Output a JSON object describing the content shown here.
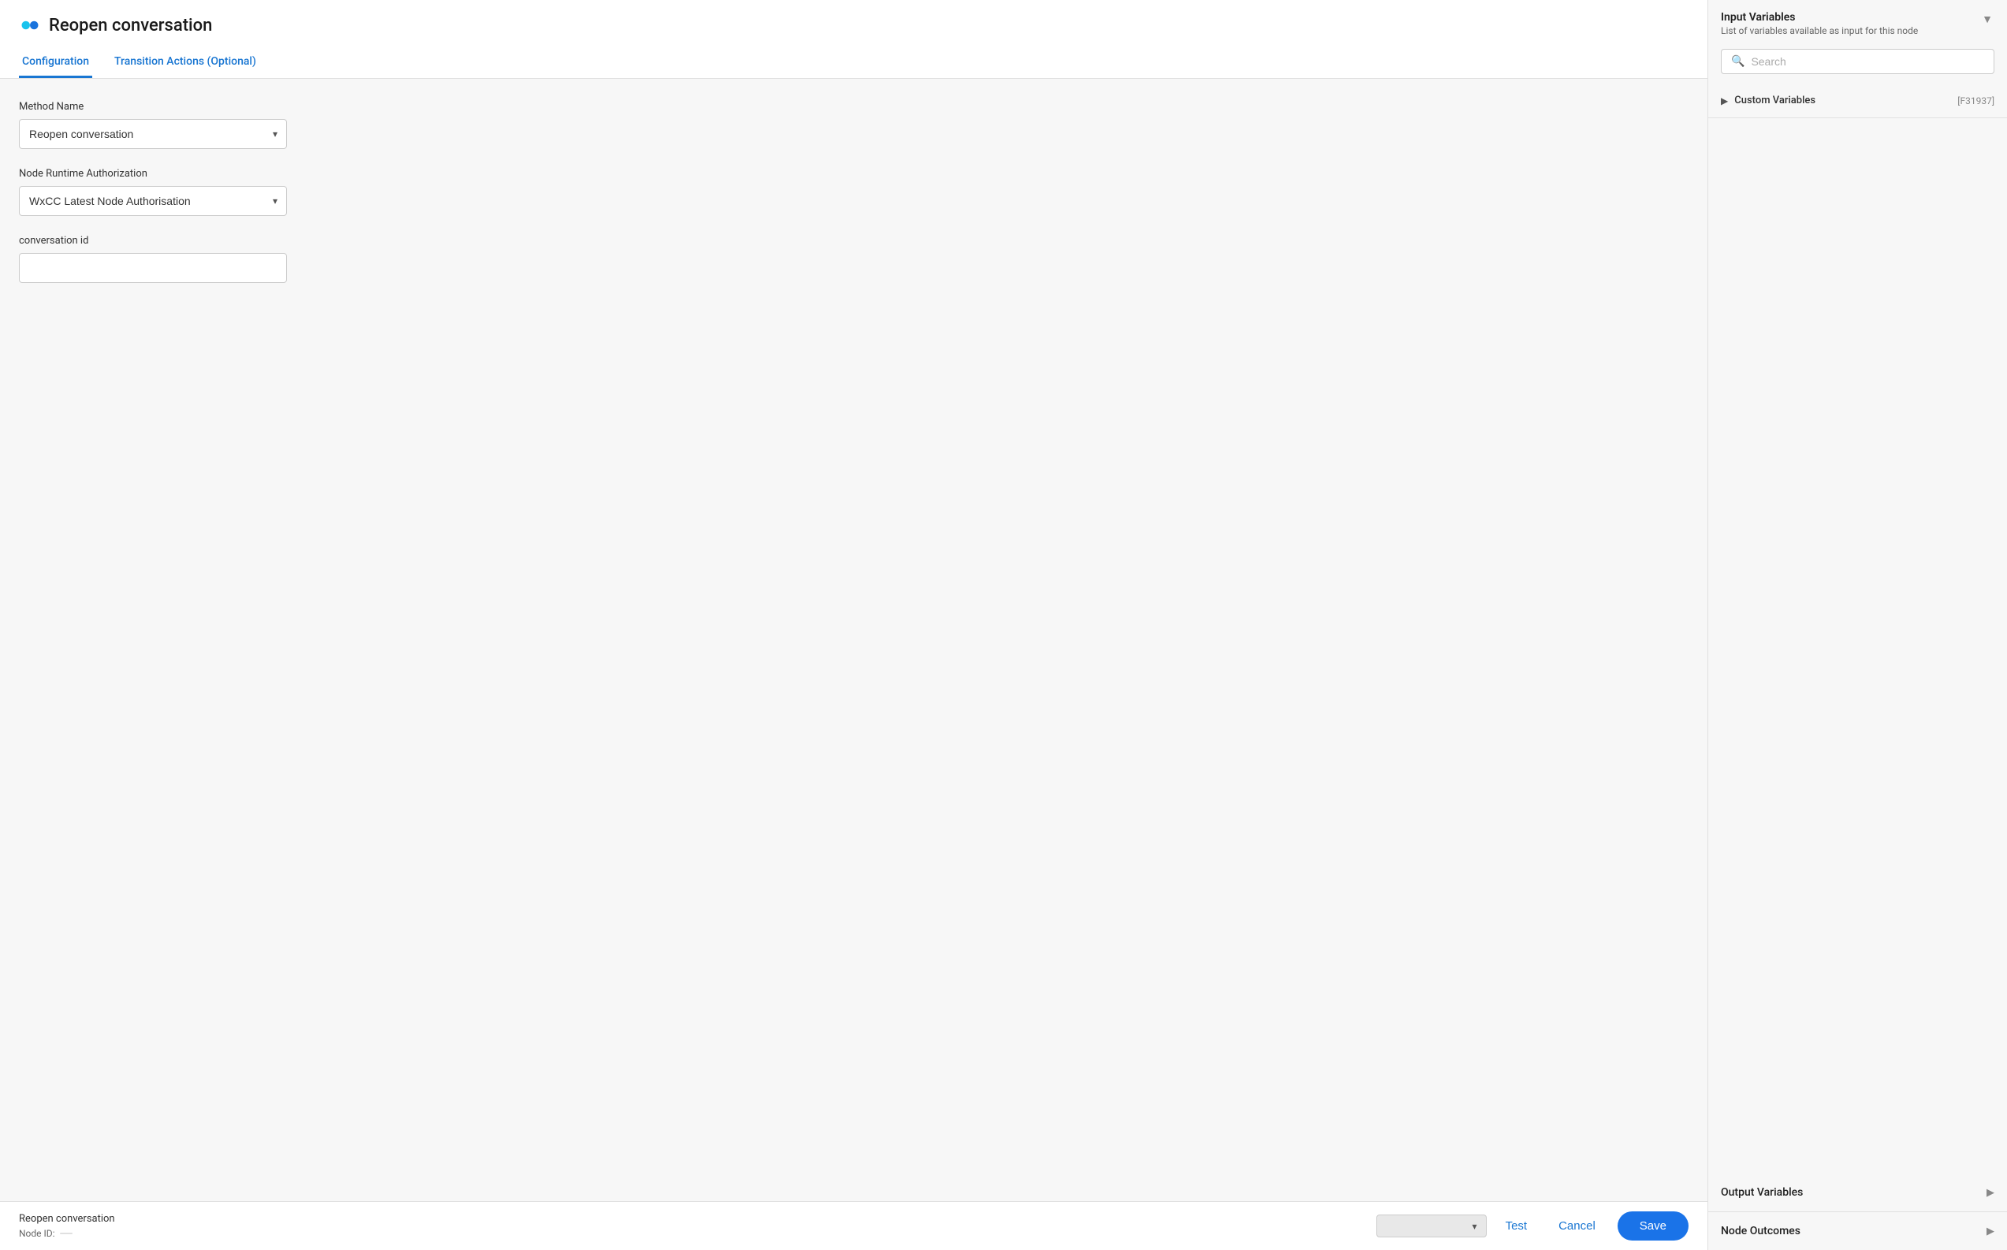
{
  "header": {
    "logo_alt": "Webex logo",
    "title": "Reopen conversation"
  },
  "tabs": [
    {
      "id": "configuration",
      "label": "Configuration",
      "active": true
    },
    {
      "id": "transition-actions",
      "label": "Transition Actions (Optional)",
      "active": false
    }
  ],
  "form": {
    "method_name": {
      "label": "Method Name",
      "value": "Reopen conversation",
      "options": [
        "Reopen conversation"
      ]
    },
    "node_runtime_auth": {
      "label": "Node Runtime Authorization",
      "value": "WxCC Latest Node Authorisation",
      "options": [
        "WxCC Latest Node Authorisation"
      ]
    },
    "conversation_id": {
      "label": "conversation id",
      "placeholder": ""
    }
  },
  "bottom_bar": {
    "node_name_label": "Reopen conversation",
    "node_id_label": "Node ID:",
    "node_id_value": "",
    "select_placeholder": ""
  },
  "actions": {
    "test_label": "Test",
    "cancel_label": "Cancel",
    "save_label": "Save"
  },
  "right_panel": {
    "input_variables": {
      "title": "Input Variables",
      "subtitle": "List of variables available as input for this node",
      "search_placeholder": "Search",
      "custom_variables_label": "Custom Variables",
      "custom_variables_badge": "[F31937]"
    },
    "output_variables": {
      "title": "Output Variables"
    },
    "node_outcomes": {
      "title": "Node Outcomes"
    }
  }
}
